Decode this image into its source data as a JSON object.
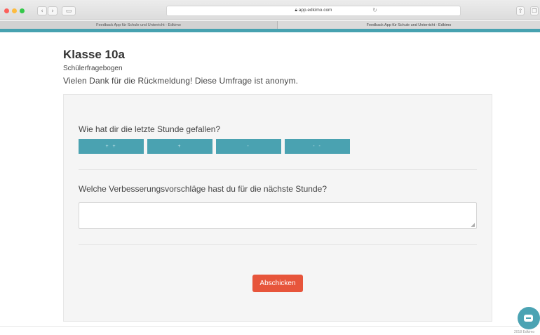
{
  "browser": {
    "url": "app.edkimo.com",
    "back_icon": "chevron-left-icon",
    "forward_icon": "chevron-right-icon",
    "tabs": [
      {
        "label": "Feedback App für Schule und Unterricht - Edkimo"
      },
      {
        "label": "Feedback App für Schule und Unterricht - Edkimo"
      }
    ]
  },
  "page": {
    "title": "Klasse 10a",
    "subtitle": "Schülerfragebogen",
    "intro": "Vielen Dank für die Rückmeldung! Diese Umfrage ist anonym."
  },
  "survey": {
    "question1": "Wie hat dir die letzte Stunde gefallen?",
    "ratings": [
      "+ +",
      "+",
      "-",
      "- -"
    ],
    "question2": "Welche Verbesserungsvorschläge hast du für die nächste Stunde?",
    "answer_value": "",
    "submit_label": "Abschicken"
  },
  "footer": {
    "copyright": "2018 Edkimo"
  },
  "colors": {
    "accent": "#47a2b0",
    "submit": "#e7553b"
  }
}
